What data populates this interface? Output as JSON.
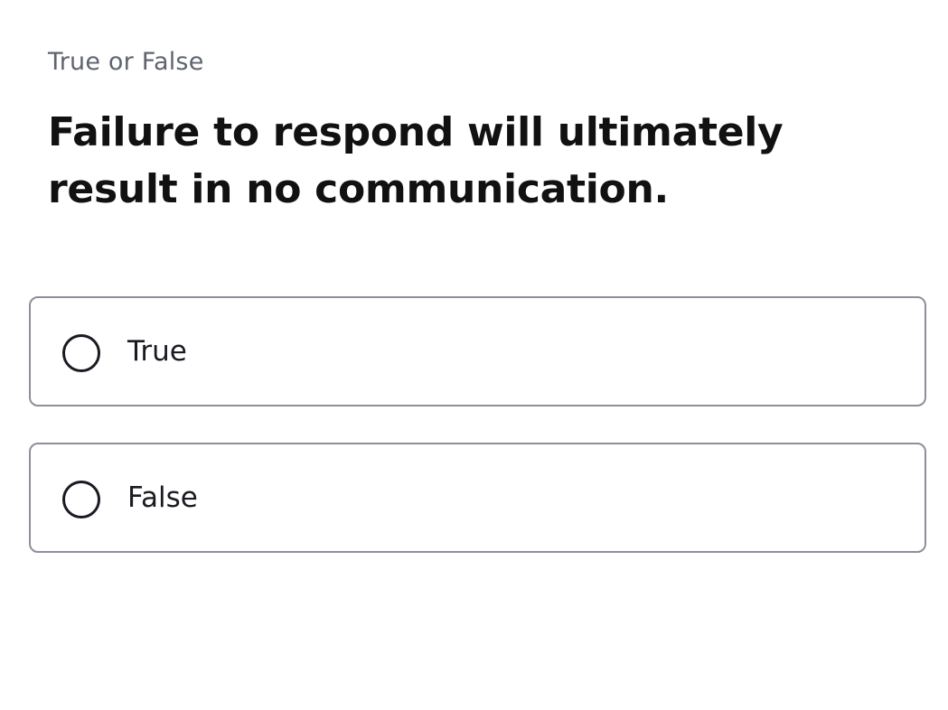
{
  "question": {
    "type_label": "True or False",
    "text": "Failure to respond will ultimately result in no communication."
  },
  "options": [
    {
      "label": "True",
      "selected": false,
      "icon": "radio-unchecked-icon"
    },
    {
      "label": "False",
      "selected": false,
      "icon": "radio-unchecked-icon"
    }
  ],
  "colors": {
    "type_label": "#5f6470",
    "question_text": "#111111",
    "option_border": "#8e8f99",
    "radio_stroke": "#1a1a22"
  }
}
